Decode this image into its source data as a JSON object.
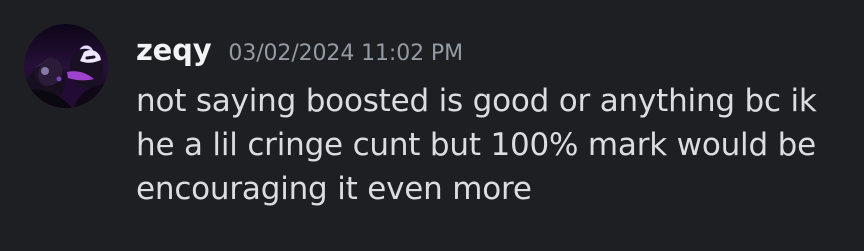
{
  "message": {
    "username": "zeqy",
    "timestamp": "03/02/2024 11:02 PM",
    "text_lines": [
      "not saying boosted is good or anything bc ik",
      "he a lil cringe cunt but 100% mark would be",
      "encouraging it even more"
    ]
  },
  "icons": {
    "avatar": "profile-avatar"
  },
  "colors": {
    "background": "#1e1f22",
    "username": "#f2f3f5",
    "timestamp": "#949ba4",
    "text": "#dbdee1"
  }
}
